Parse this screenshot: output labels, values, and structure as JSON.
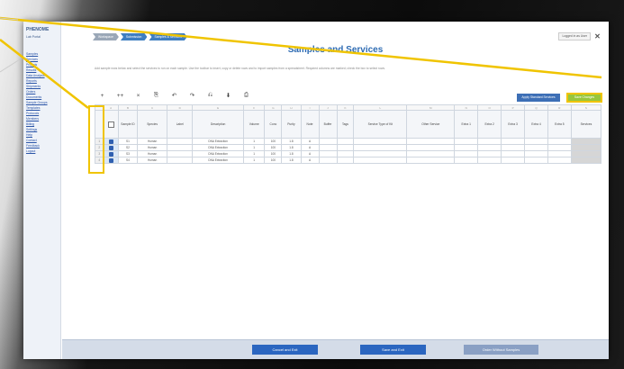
{
  "sidebar": {
    "logo": "PHENOME",
    "logo_sub": "Lab Portal",
    "items": [
      "Samples",
      "Services",
      "Projects",
      "Results",
      "Data Analysis",
      "Reports",
      "Shipments",
      "Orders",
      "Documents",
      "Sample Groups",
      "Templates",
      "Protocols",
      "Members",
      "Billing",
      "Settings",
      "Help",
      "Contact",
      "Feedback",
      "Logout"
    ]
  },
  "breadcrumbs": [
    "Workspace",
    "Submission",
    "Samples & Services"
  ],
  "user_box": "Logged in as User",
  "page_title": "Samples and Services",
  "description": "Add sample rows below and select the services to run on each sample. Use the toolbar to insert, copy or delete rows and to import samples from a spreadsheet. Required columns are marked; check the box to select rows.",
  "toolbar": {
    "tools": [
      "+",
      "++",
      "×",
      "⎘",
      "↶",
      "↷",
      "⎌",
      "⬇",
      "⎙"
    ]
  },
  "buttons": {
    "standard_services": "Apply Standard Services",
    "save_top": "Save Changes",
    "cancel": "Cancel and Exit",
    "save_exit": "Save and Exit",
    "more": "Order Without Samples"
  },
  "table": {
    "letters": [
      "",
      "A",
      "B",
      "C",
      "D",
      "E",
      "F",
      "G",
      "H",
      "I",
      "J",
      "K",
      "L",
      "M",
      "N",
      "O",
      "P",
      "Q",
      "R",
      "S"
    ],
    "headers": [
      "",
      "Sample ID",
      "Species",
      "Label",
      "Description",
      "Volume",
      "Conc",
      "Purity",
      "Note",
      "Buffer",
      "Tags",
      "Service Type of Kit",
      "Other Service",
      "Extra 1",
      "Extra 2",
      "Extra 3",
      "Extra 4",
      "Extra 5",
      "Services"
    ],
    "rows": [
      [
        "1",
        "S1",
        "Human",
        "",
        "DNA Extraction",
        "1",
        "100",
        "1.8",
        "A",
        "",
        "",
        "",
        "",
        "",
        "",
        "",
        "",
        "",
        ""
      ],
      [
        "2",
        "S2",
        "Human",
        "",
        "DNA Extraction",
        "1",
        "100",
        "1.8",
        "A",
        "",
        "",
        "",
        "",
        "",
        "",
        "",
        "",
        "",
        ""
      ],
      [
        "3",
        "S3",
        "Human",
        "",
        "DNA Extraction",
        "1",
        "100",
        "1.8",
        "A",
        "",
        "",
        "",
        "",
        "",
        "",
        "",
        "",
        "",
        ""
      ],
      [
        "4",
        "S4",
        "Human",
        "",
        "DNA Extraction",
        "1",
        "100",
        "1.8",
        "A",
        "",
        "",
        "",
        "",
        "",
        "",
        "",
        "",
        "",
        ""
      ]
    ]
  },
  "colors": {
    "accent": "#2f6cb3",
    "highlight": "#f0c400",
    "save_green": "#97c63c"
  }
}
